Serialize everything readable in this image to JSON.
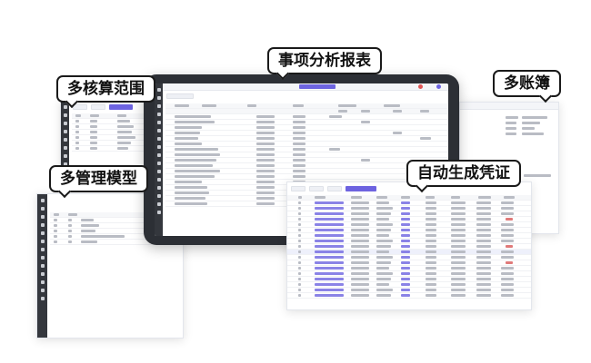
{
  "callouts": {
    "event_analysis": "事项分析报表",
    "multi_accounting_scope": "多核算范围",
    "multi_ledger": "多账簿",
    "multi_management_model": "多管理模型",
    "auto_voucher": "自动生成凭证"
  },
  "colors": {
    "accent": "#6d63e0",
    "sidebar": "#34373d",
    "callout_border": "#1a1a1a"
  }
}
